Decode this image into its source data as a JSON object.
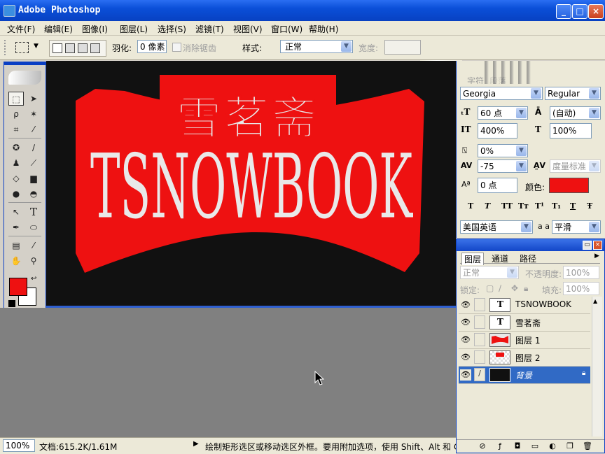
{
  "app": {
    "title": "Adobe Photoshop"
  },
  "window_buttons": {
    "minimize": "_",
    "maximize": "□",
    "close": "×"
  },
  "menu": [
    "文件(F)",
    "编辑(E)",
    "图像(I)",
    "图层(L)",
    "选择(S)",
    "滤镜(T)",
    "视图(V)",
    "窗口(W)",
    "帮助(H)"
  ],
  "options": {
    "feather_label": "羽化:",
    "feather_value": "0 像素",
    "antialias_label": "消除锯齿",
    "style_label": "样式:",
    "style_value": "正常",
    "width_label": "宽度:"
  },
  "artwork": {
    "chinese_text": "雪茗斋",
    "main_text": "TSNOWBOOK",
    "banner_color": "#ee1111",
    "background_color": "#111111",
    "text_color": "#e9e9e9"
  },
  "toolbox": {
    "tools": [
      "选框",
      "移动",
      "套索",
      "魔棒",
      "裁剪",
      "切片",
      "修复",
      "画笔",
      "图章",
      "历史画笔",
      "橡皮擦",
      "渐变",
      "模糊",
      "减淡",
      "路径选择",
      "文字",
      "钢笔",
      "形状",
      "注释",
      "吸管",
      "抓手",
      "缩放"
    ],
    "foreground_color": "#ee1111",
    "background_color": "#ffffff"
  },
  "status": {
    "zoom": "100%",
    "doc_info": "文档:615.2K/1.61M",
    "hint": "绘制矩形选区或移动选区外框。要用附加选项，使用 Shift、Alt 和 C"
  },
  "character_panel": {
    "tabs": [
      "字符",
      "段落"
    ],
    "font_family": "Georgia",
    "font_style": "Regular",
    "font_size": "60 点",
    "leading": "(自动)",
    "vertical_scale": "400%",
    "horizontal_scale": "100%",
    "scale_ratio": "0%",
    "tracking": "-75",
    "kerning": "度量标准",
    "baseline_shift": "0 点",
    "color_label": "颜色:",
    "color_value": "#ee1111",
    "style_buttons": [
      "T",
      "T",
      "TT",
      "Tт",
      "T¹",
      "T₁",
      "T",
      "Ŧ"
    ],
    "language": "美国英语",
    "aa_label": "a a",
    "antialias": "平滑"
  },
  "layers_panel": {
    "tabs": [
      "图层",
      "通道",
      "路径"
    ],
    "blend_mode": "正常",
    "opacity_label": "不透明度:",
    "opacity_value": "100%",
    "lock_label": "锁定:",
    "fill_label": "填充:",
    "fill_value": "100%",
    "layers": [
      {
        "name": "TSNOWBOOK",
        "kind": "text",
        "selected": false
      },
      {
        "name": "雪茗斋",
        "kind": "text",
        "selected": false
      },
      {
        "name": "图层 1",
        "kind": "banner",
        "selected": false
      },
      {
        "name": "图层 2",
        "kind": "red-rect",
        "selected": false
      },
      {
        "name": "背景",
        "kind": "background",
        "selected": true
      }
    ]
  }
}
